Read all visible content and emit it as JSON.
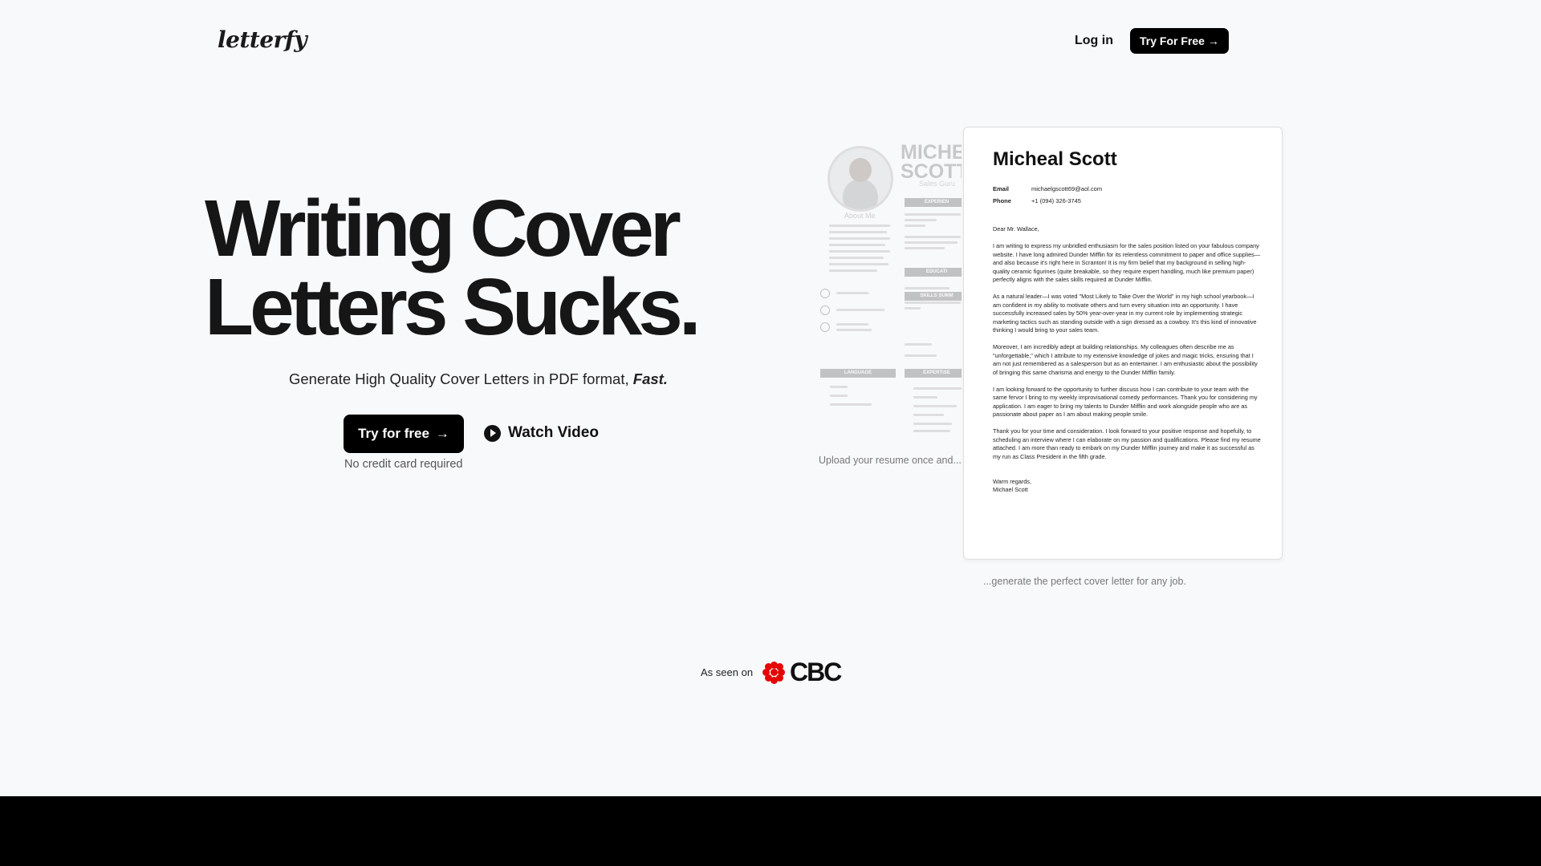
{
  "nav": {
    "logo": "letterfy",
    "login_label": "Log in",
    "cta_label": "Try For Free",
    "cta_arrow": "→"
  },
  "hero": {
    "headline_line1": "Writing Cover",
    "headline_line2": "Letters Sucks.",
    "subtitle_prefix": "Generate High Quality Cover Letters in PDF format, ",
    "subtitle_emphasis": "Fast.",
    "cta_label": "Try for free",
    "cta_arrow": "→",
    "watch_label": "Watch Video",
    "note": "No credit card required"
  },
  "resume_preview": {
    "name_line1": "MICHEA",
    "name_line2": "SCOTT",
    "title": "Sales Guru",
    "about_heading": "About Me",
    "section_experience": "EXPERIEN",
    "section_education": "EDUCATI",
    "section_skills": "SKILLS SUMM",
    "section_language": "LANGUAGE",
    "section_expertise": "EXPERTISE",
    "caption": "Upload your resume once and..."
  },
  "cover_letter": {
    "name": "Micheal Scott",
    "email_label": "Email",
    "email": "michaelgscott69@aol.com",
    "phone_label": "Phone",
    "phone": "+1 (094) 326-3745",
    "salutation": "Dear Mr. Wallace,",
    "paragraph_1": "I am writing to express my unbridled enthusiasm for the sales position listed on your fabulous company website. I have long admired Dunder Mifflin for its relentless commitment to paper and office supplies—and also because it's right here in Scranton! It is my firm belief that my background in selling high-quality ceramic figurines (quite breakable, so they require expert handling, much like premium paper) perfectly aligns with the sales skills required at Dunder Mifflin.",
    "paragraph_2": "As a natural leader—I was voted \"Most Likely to Take Over the World\" in my high school yearbook—I am confident in my ability to motivate others and turn every situation into an opportunity. I have successfully increased sales by 50% year-over-year in my current role by implementing strategic marketing tactics such as standing outside with a sign dressed as a cowboy. It's this kind of innovative thinking I would bring to your sales team.",
    "paragraph_3": "Moreover, I am incredibly adept at building relationships. My colleagues often describe me as \"unforgettable,\" which I attribute to my extensive knowledge of jokes and magic tricks, ensuring that I am not just remembered as a salesperson but as an entertainer. I am enthusiastic about the possibility of bringing this same charisma and energy to the Dunder Mifflin family.",
    "paragraph_4": "I am looking forward to the opportunity to further discuss how I can contribute to your team with the same fervor I bring to my weekly improvisational comedy performances. Thank you for considering my application. I am eager to bring my talents to Dunder Mifflin and work alongside people who are as passionate about paper as I am about making people smile.",
    "paragraph_5": "Thank you for your time and consideration. I look forward to your positive response and hopefully, to scheduling an interview where I can elaborate on my passion and qualifications. Please find my resume attached. I am more than ready to embark on my Dunder Mifflin journey and make it as successful as my run as Class President in the fifth grade.",
    "closing": "Warm regards,",
    "signature": "Michael Scott",
    "caption": "...generate the perfect cover letter for any job."
  },
  "press": {
    "label": "As seen on",
    "logo_text": "CBC",
    "logo_color": "#e60505"
  },
  "colors": {
    "background": "#f8f9fb",
    "primary": "#000000",
    "footer": "#000000"
  }
}
